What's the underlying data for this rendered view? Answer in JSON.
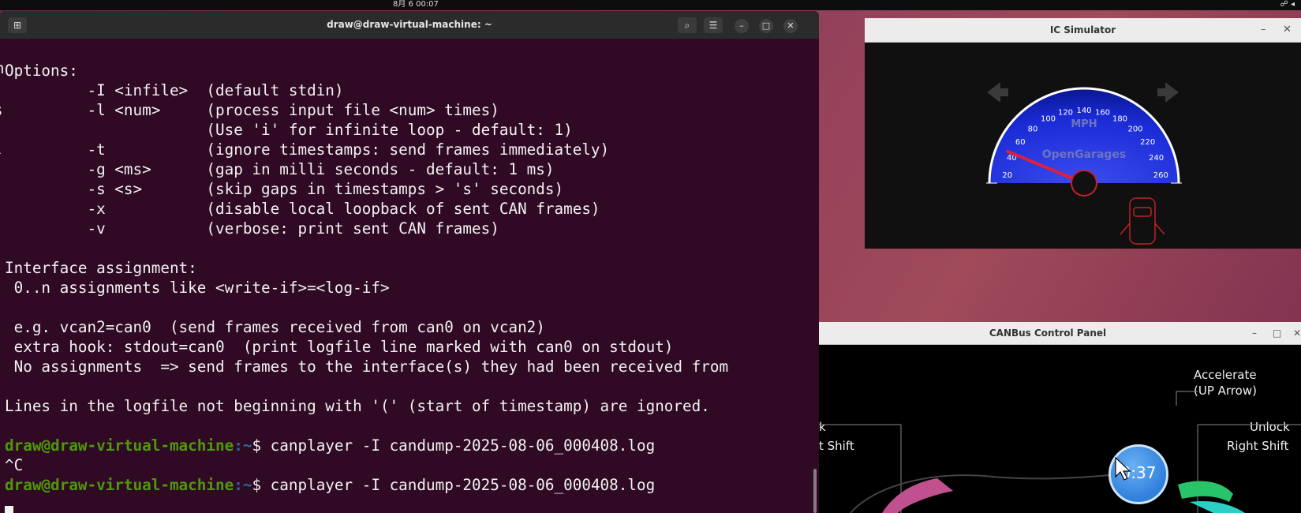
{
  "system": {
    "clock": "8月 6 00:07",
    "tray": "☍ ◂"
  },
  "terminal": {
    "title": "draw@draw-virtual-machine: ~",
    "lines": [
      "Options:",
      "         -I <infile>  (default stdin)",
      "         -l <num>     (process input file <num> times)",
      "                      (Use 'i' for infinite loop - default: 1)",
      "         -t           (ignore timestamps: send frames immediately)",
      "         -g <ms>      (gap in milli seconds - default: 1 ms)",
      "         -s <s>       (skip gaps in timestamps > 's' seconds)",
      "         -x           (disable local loopback of sent CAN frames)",
      "         -v           (verbose: print sent CAN frames)",
      "",
      "Interface assignment:",
      " 0..n assignments like <write-if>=<log-if>",
      "",
      " e.g. vcan2=can0  (send frames received from can0 on vcan2)",
      " extra hook: stdout=can0  (print logfile line marked with can0 on stdout)",
      " No assignments  => send frames to the interface(s) they had been received from",
      "",
      "Lines in the logfile not beginning with '(' (start of timestamp) are ignored.",
      ""
    ],
    "prompt_user": "draw@draw-virtual-machine",
    "prompt_path": ":~",
    "prompt_sign": "$ ",
    "command1": "canplayer -I candump-2025-08-06_000408.log",
    "interrupt": "^C",
    "command2": "canplayer -I candump-2025-08-06_000408.log",
    "left_edge": [
      "n",
      "s",
      ")",
      "l"
    ]
  },
  "ic_simulator": {
    "title": "IC Simulator",
    "unit": "MPH",
    "brand": "OpenGarages",
    "ticks": [
      "20",
      "40",
      "60",
      "80",
      "100",
      "120",
      "140",
      "160",
      "180",
      "200",
      "220",
      "240",
      "260"
    ],
    "speed_value": 35,
    "colors": {
      "dial": "#1a2bd6",
      "needle": "#e0203a",
      "door": "#c0202a"
    }
  },
  "canbus_panel": {
    "title": "CANBus Control Panel",
    "accelerate_label": "Accelerate",
    "accelerate_hint": "(UP Arrow)",
    "left_label_1": "k",
    "left_label_2": "t Shift",
    "unlock_label": "Unlock",
    "right_shift_label": "Right Shift",
    "timer": "0:37"
  }
}
